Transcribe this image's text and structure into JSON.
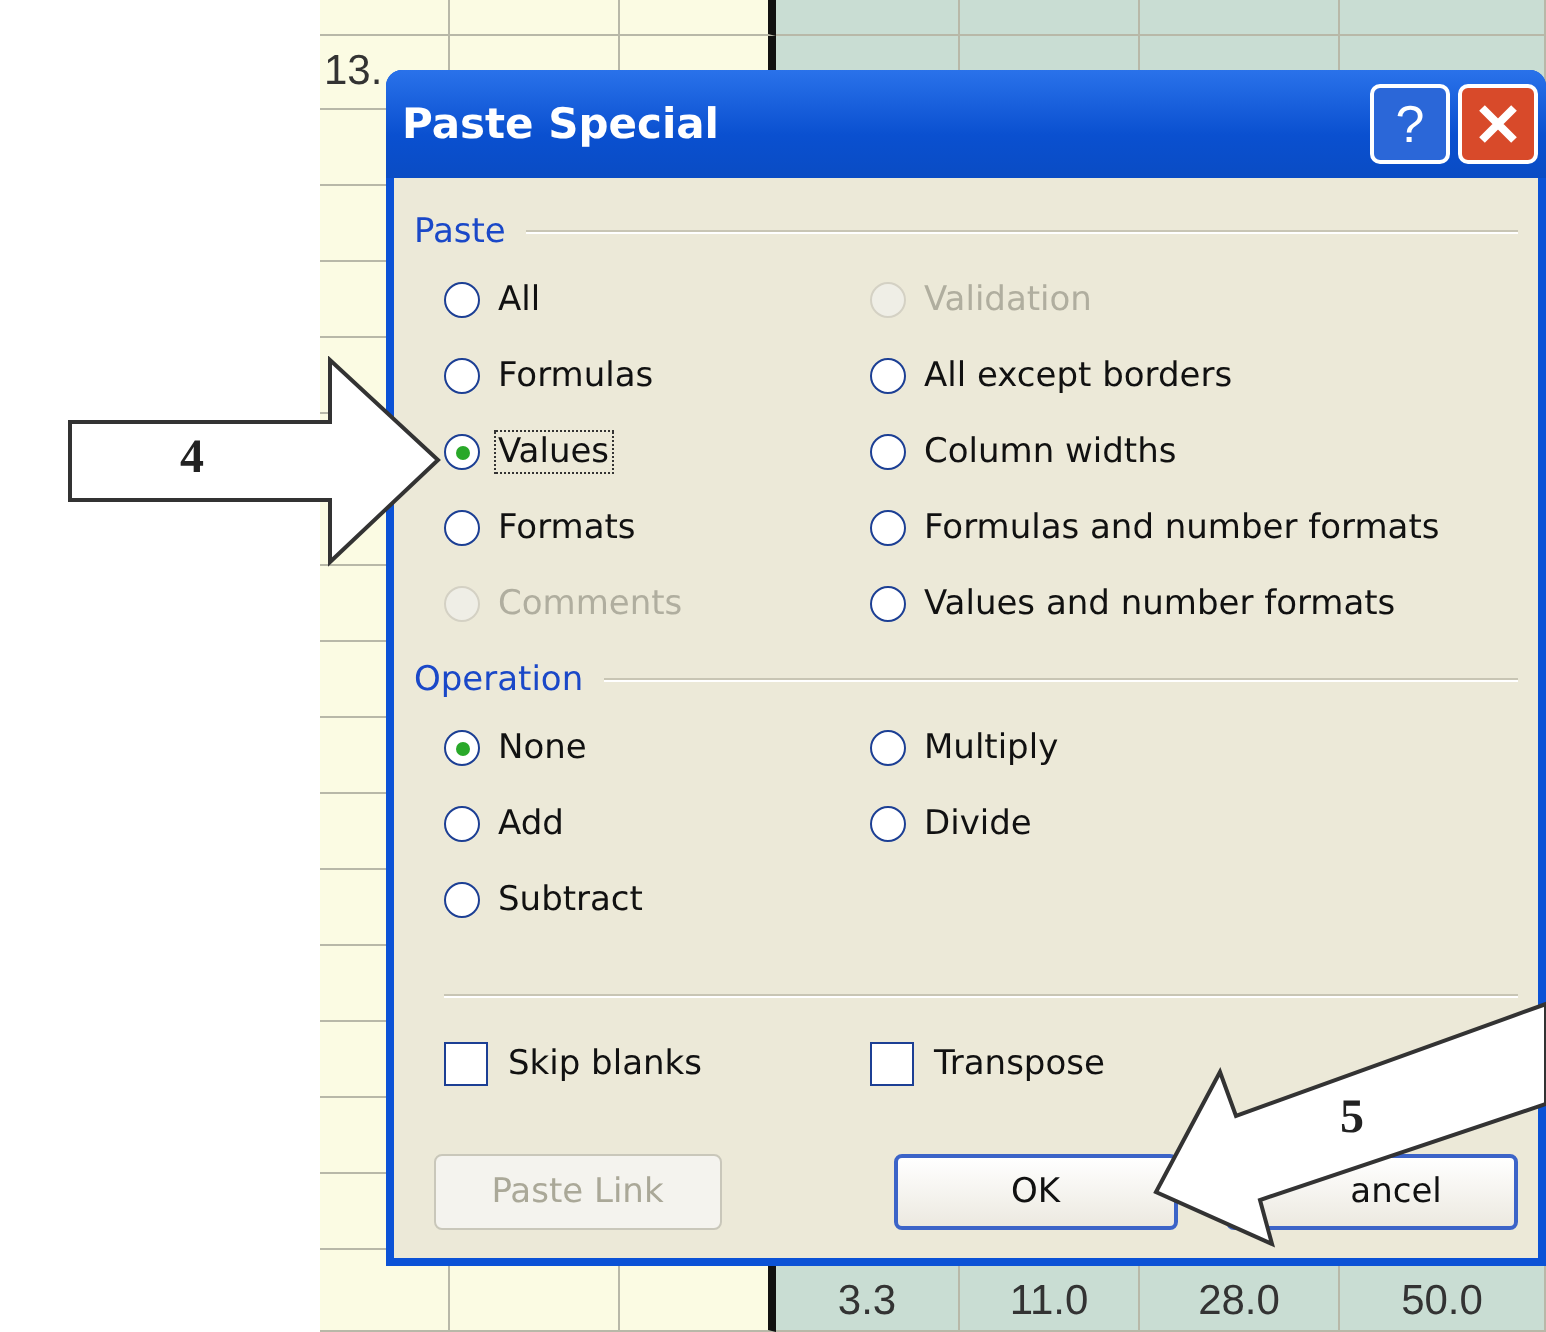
{
  "sheet": {
    "row_1": {
      "column_1": "13."
    },
    "last_row": [
      "3.3",
      "11.0",
      "28.0",
      "50.0"
    ]
  },
  "window": {
    "title": "Paste Special",
    "help_label": "?"
  },
  "paste": {
    "label": "Paste",
    "columns": [
      [
        {
          "label": "All",
          "selected": false,
          "disabled": false,
          "focused": false
        },
        {
          "label": "Formulas",
          "selected": false,
          "disabled": false,
          "focused": false
        },
        {
          "label": "Values",
          "selected": true,
          "disabled": false,
          "focused": true
        },
        {
          "label": "Formats",
          "selected": false,
          "disabled": false,
          "focused": false
        },
        {
          "label": "Comments",
          "selected": false,
          "disabled": true,
          "focused": false
        }
      ],
      [
        {
          "label": "Validation",
          "selected": false,
          "disabled": true,
          "focused": false
        },
        {
          "label": "All except borders",
          "selected": false,
          "disabled": false,
          "focused": false
        },
        {
          "label": "Column widths",
          "selected": false,
          "disabled": false,
          "focused": false
        },
        {
          "label": "Formulas and number formats",
          "selected": false,
          "disabled": false,
          "focused": false
        },
        {
          "label": "Values and number formats",
          "selected": false,
          "disabled": false,
          "focused": false
        }
      ]
    ]
  },
  "operation": {
    "label": "Operation",
    "columns": [
      [
        {
          "label": "None",
          "selected": true
        },
        {
          "label": "Add",
          "selected": false
        },
        {
          "label": "Subtract",
          "selected": false
        }
      ],
      [
        {
          "label": "Multiply",
          "selected": false
        },
        {
          "label": "Divide",
          "selected": false
        }
      ]
    ]
  },
  "checkboxes": [
    {
      "label": "Skip blanks",
      "checked": false
    },
    {
      "label": "Transpose",
      "checked": false
    }
  ],
  "buttons": [
    {
      "label": "Paste Link",
      "disabled": true
    },
    {
      "label": "OK",
      "disabled": false
    },
    {
      "label": "ancel",
      "disabled": false
    }
  ],
  "callouts": [
    {
      "kind": "right",
      "number": "4"
    },
    {
      "kind": "diagonal",
      "number": "5"
    }
  ]
}
